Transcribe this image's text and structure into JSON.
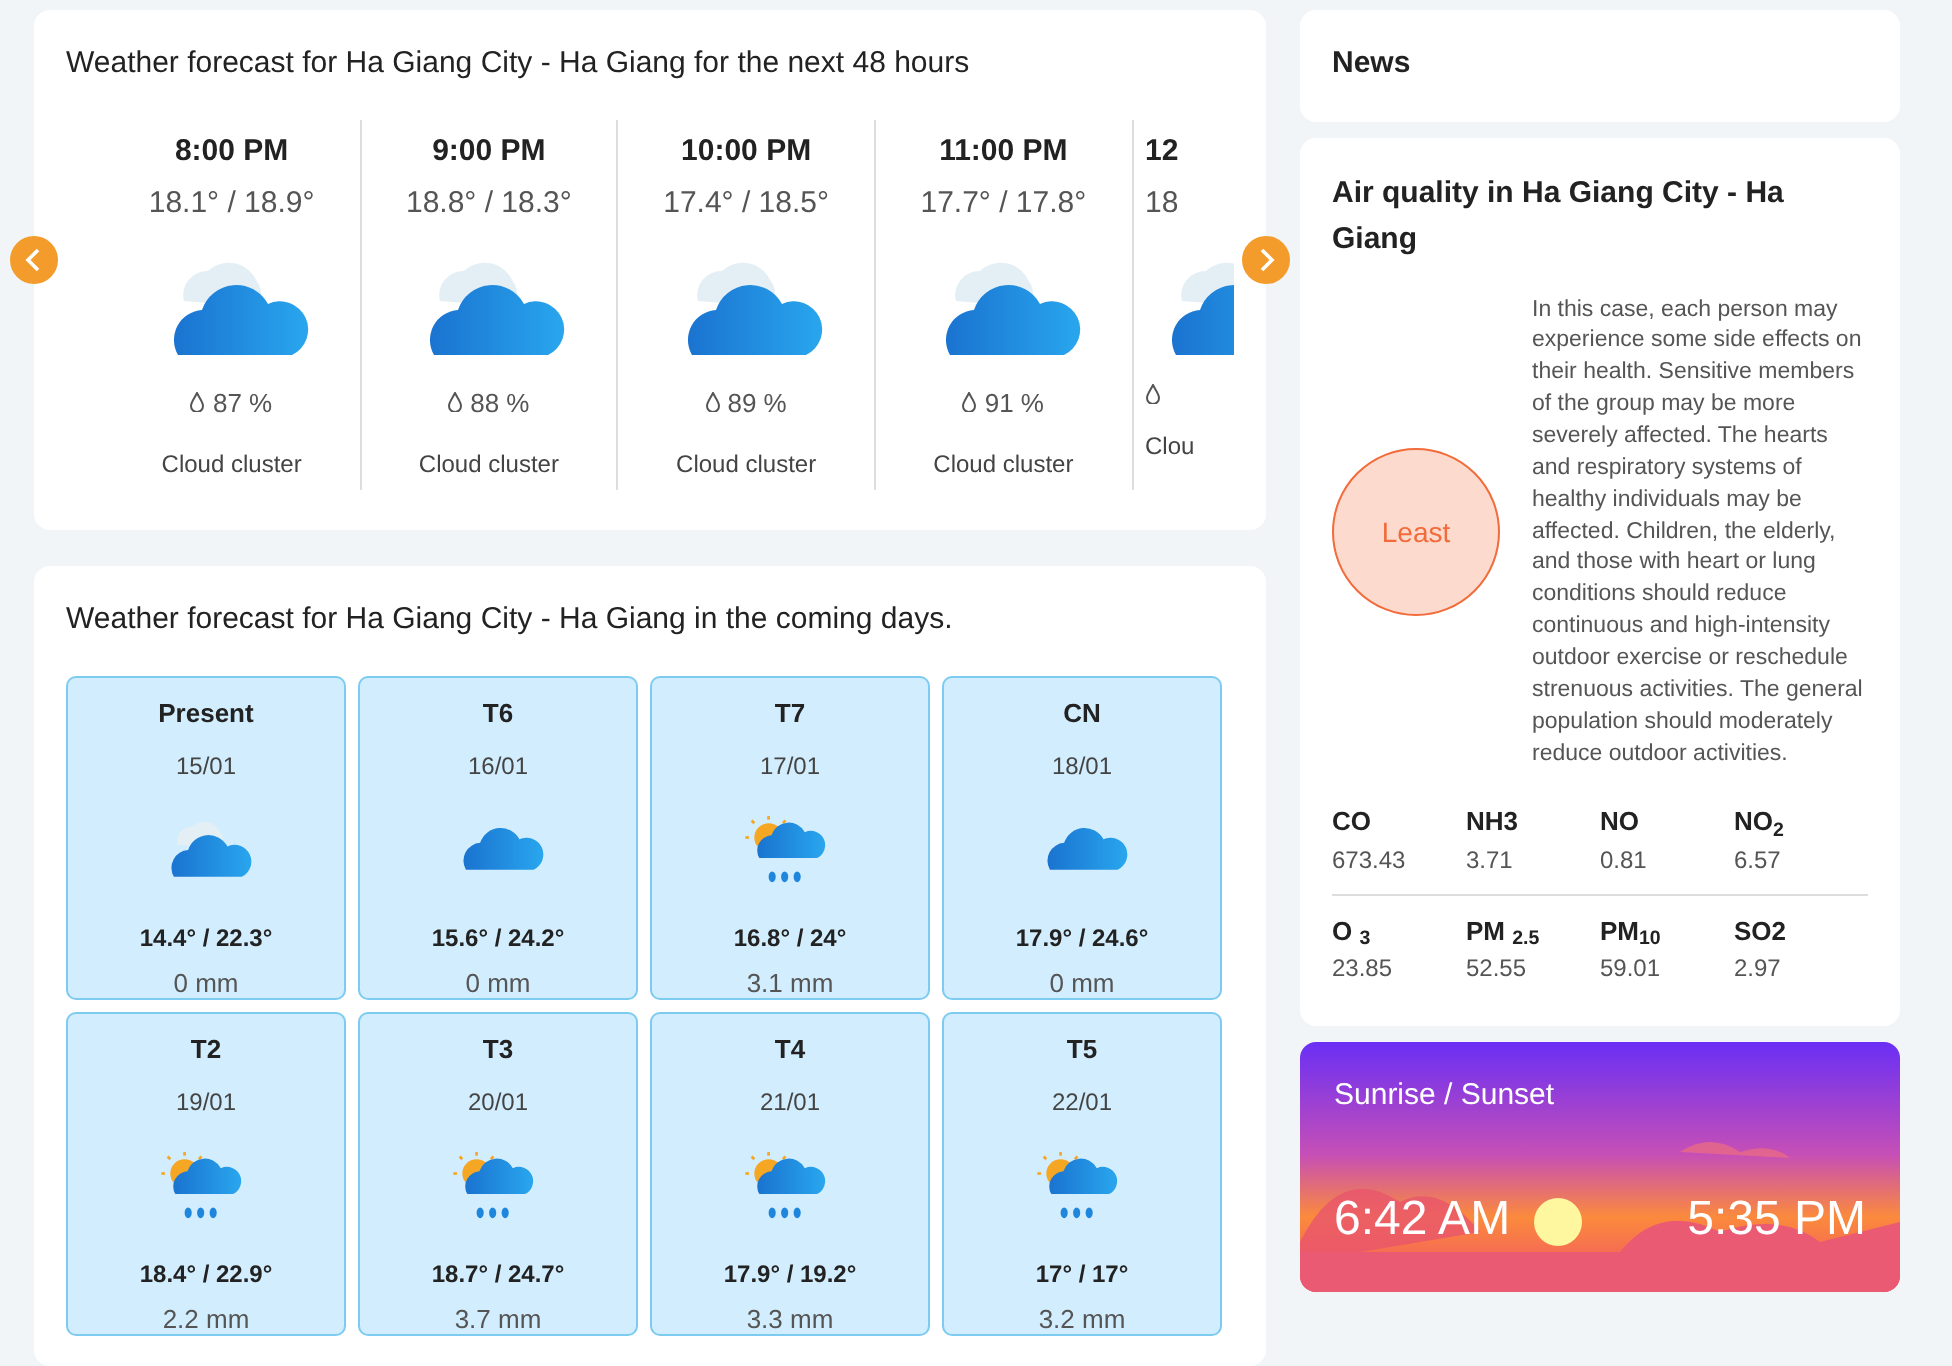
{
  "hourly": {
    "title": "Weather forecast for Ha Giang City - Ha Giang for the next 48 hours",
    "items": [
      {
        "time": "8:00 PM",
        "temps": "18.1° / 18.9°",
        "kind": "cloudy",
        "humidity": "87 %",
        "condition": "Cloud cluster"
      },
      {
        "time": "9:00 PM",
        "temps": "18.8° / 18.3°",
        "kind": "cloudy",
        "humidity": "88 %",
        "condition": "Cloud cluster"
      },
      {
        "time": "10:00 PM",
        "temps": "17.4° / 18.5°",
        "kind": "cloudy",
        "humidity": "89 %",
        "condition": "Cloud cluster"
      },
      {
        "time": "11:00 PM",
        "temps": "17.7° / 17.8°",
        "kind": "cloudy",
        "humidity": "91 %",
        "condition": "Cloud cluster"
      },
      {
        "time": "12",
        "temps": "18",
        "kind": "cloudy",
        "condition": "Clou"
      }
    ]
  },
  "daily": {
    "title": "Weather forecast for Ha Giang City - Ha Giang in the coming days.",
    "items": [
      {
        "day": "Present",
        "date": "15/01",
        "kind": "cloudy",
        "temps": "14.4° / 22.3°",
        "rain": "0 mm"
      },
      {
        "day": "T6",
        "date": "16/01",
        "kind": "cloud",
        "temps": "15.6° / 24.2°",
        "rain": "0 mm"
      },
      {
        "day": "T7",
        "date": "17/01",
        "kind": "sun-rain",
        "temps": "16.8° / 24°",
        "rain": "3.1 mm"
      },
      {
        "day": "CN",
        "date": "18/01",
        "kind": "cloud",
        "temps": "17.9° / 24.6°",
        "rain": "0 mm"
      },
      {
        "day": "T2",
        "date": "19/01",
        "kind": "sun-rain",
        "temps": "18.4° / 22.9°",
        "rain": "2.2 mm"
      },
      {
        "day": "T3",
        "date": "20/01",
        "kind": "sun-rain",
        "temps": "18.7° / 24.7°",
        "rain": "3.7 mm"
      },
      {
        "day": "T4",
        "date": "21/01",
        "kind": "sun-rain",
        "temps": "17.9° / 19.2°",
        "rain": "3.3 mm"
      },
      {
        "day": "T5",
        "date": "22/01",
        "kind": "sun-rain",
        "temps": "17° / 17°",
        "rain": "3.2 mm"
      }
    ]
  },
  "news": {
    "title": "News"
  },
  "air_quality": {
    "title": "Air quality in Ha Giang City - Ha Giang",
    "level_label": "Least",
    "color": "#f26b3a",
    "description": "In this case, each person may experience some side effects on their health. Sensitive members of the group may be more severely affected. The hearts and respiratory systems of healthy individuals may be affected. Children, the elderly, and those with heart or lung conditions should reduce continuous and high-intensity outdoor exercise or reschedule strenuous activities. The general population should moderately reduce outdoor activities.",
    "pollutants": [
      {
        "name": "CO",
        "value": "673.43"
      },
      {
        "name": "NH3",
        "value": "3.71"
      },
      {
        "name": "NO",
        "value": "0.81"
      },
      {
        "name": "NO$_{2}$",
        "value": "6.57"
      },
      {
        "name": "O $_{3}$",
        "value": "23.85"
      },
      {
        "name": "PM $_{2.5}$",
        "value": "52.55"
      },
      {
        "name": "PM$_{10}$",
        "value": "59.01"
      },
      {
        "name": "SO2",
        "value": "2.97"
      }
    ]
  },
  "sun": {
    "title": "Sunrise / Sunset",
    "sunrise": "6:42 AM",
    "sunset": "5:35 PM"
  }
}
